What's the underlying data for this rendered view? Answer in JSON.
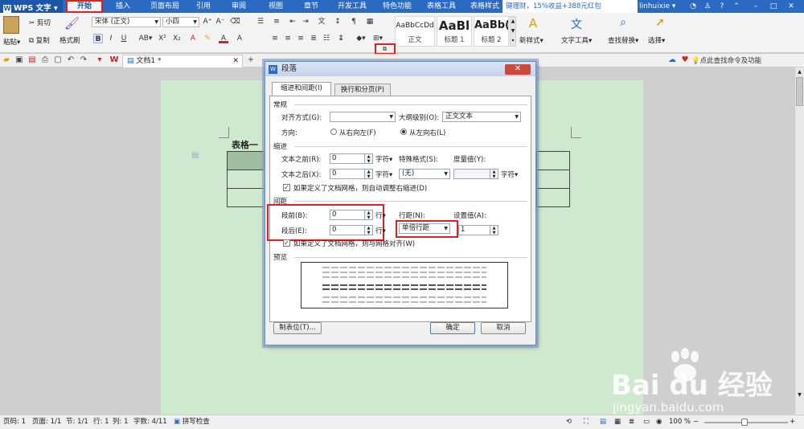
{
  "app": {
    "name": "WPS 文字"
  },
  "tabs": [
    "开始",
    "插入",
    "页面布局",
    "引用",
    "审阅",
    "视图",
    "章节",
    "开发工具",
    "特色功能",
    "表格工具",
    "表格样式"
  ],
  "promo": "键理财，15%收益+388元红包",
  "user": "linhuixie",
  "ribbon": {
    "paste": "粘贴",
    "cut": "剪切",
    "copy": "复制",
    "format_painter": "格式刷",
    "font_name": "宋体 (正文)",
    "font_size": "小四",
    "styles": [
      {
        "sample": "AaBbCcDd",
        "name": "正文"
      },
      {
        "sample": "AaBl",
        "name": "标题 1"
      },
      {
        "sample": "AaBb(",
        "name": "标题 2"
      }
    ],
    "new_style": "新样式",
    "text_tools": "文字工具",
    "find_replace": "查找替换",
    "select": "选择"
  },
  "doc_tab": {
    "title": "文档1 *"
  },
  "search_hint": "点此查找命令及功能",
  "document": {
    "table_title": "表格一"
  },
  "status": {
    "page": "页码: 1",
    "pages": "页面: 1/1",
    "section": "节: 1/1",
    "row": "行: 1",
    "col": "列: 1",
    "words": "字数: 4/11",
    "spell": "拼写检查",
    "zoom": "100 %"
  },
  "dialog": {
    "title": "段落",
    "tab_indent": "缩进和间距(I)",
    "tab_break": "换行和分页(P)",
    "general": "常规",
    "align_label": "对齐方式(G):",
    "align_value": "",
    "outline_label": "大纲级别(O):",
    "outline_value": "正文文本",
    "direction_label": "方向:",
    "rtl": "从右向左(F)",
    "ltr": "从左向右(L)",
    "indent": "缩进",
    "before_text_label": "文本之前(R):",
    "before_text_value": "0",
    "after_text_label": "文本之后(X):",
    "after_text_value": "0",
    "char_unit": "字符",
    "special_label": "特殊格式(S):",
    "special_value": "(无)",
    "measure_label": "度量值(Y):",
    "grid_indent": "如果定义了文档网格，则自动调整右缩进(D)",
    "spacing": "间距",
    "before_label": "段前(B):",
    "before_value": "0",
    "after_label": "段后(E):",
    "after_value": "0",
    "line_unit": "行",
    "linespacing_label": "行距(N):",
    "linespacing_value": "单倍行距",
    "setting_label": "设置值(A):",
    "setting_value": "1",
    "grid_snap": "如果定义了文档网格，则与网格对齐(W)",
    "preview": "预览",
    "tabs_btn": "制表位(T)...",
    "ok": "确定",
    "cancel": "取消"
  },
  "watermark": {
    "brand": "Bai du 经验",
    "url": "jingyan.baidu.com"
  }
}
